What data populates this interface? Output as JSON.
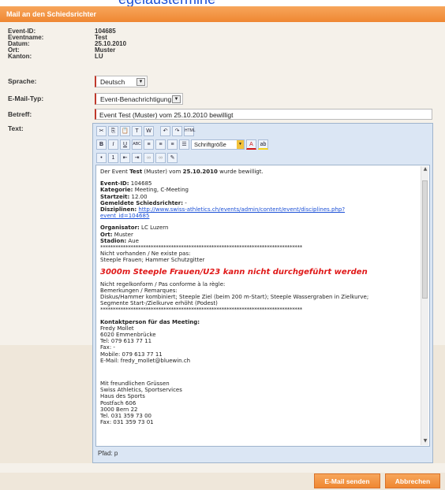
{
  "window": {
    "top_link_text": "egelaustermine",
    "title": "Mail an den Schiedsrichter"
  },
  "event_info": [
    {
      "label": "Event-ID:",
      "value": "104685"
    },
    {
      "label": "Eventname:",
      "value": "Test"
    },
    {
      "label": "Datum:",
      "value": "25.10.2010"
    },
    {
      "label": "Ort:",
      "value": "Muster"
    },
    {
      "label": "Kanton:",
      "value": "LU"
    }
  ],
  "form": {
    "sprache_label": "Sprache:",
    "sprache_value": "Deutsch",
    "mailtyp_label": "E-Mail-Typ:",
    "mailtyp_value": "Event-Benachrichtigung",
    "betreff_label": "Betreff:",
    "betreff_value": "Event Test (Muster) vom 25.10.2010 bewilligt",
    "text_label": "Text:"
  },
  "editor": {
    "toolbar_font_size": "Schriftgröße",
    "path_label": "Pfad: p",
    "body": {
      "l1a": "Der Event ",
      "l1b": "Test",
      "l1c": " (Muster) vom ",
      "l1d": "25.10.2010",
      "l1e": " wurde bewilligt.",
      "eventid_label": "Event-ID:",
      "eventid_value": " 104685",
      "kategorie_label": "Kategorie:",
      "kategorie_value": " Meeting, C-Meeting",
      "startzeit_label": "Startzeit:",
      "startzeit_value": " 12.00",
      "schiri_label": "Gemeldete Schiedsrichter:",
      "schiri_value": " -",
      "disziplinen_label": "Disziplinen:",
      "disziplinen_link1": "http://www.swiss-athletics.ch/events/admin/content/event/disciplines.php?",
      "disziplinen_link2": "event_id=104685",
      "organisator_label": "Organisator:",
      "organisator_value": " LC Luzern",
      "ort_label": "Ort:",
      "ort_value": " Muster",
      "stadion_label": "Stadion:",
      "stadion_value": " Aue",
      "stars": "********************************************************************************",
      "nicht_vorhanden": "Nicht vorhanden / Ne existe pas:",
      "steeple_list": "Steeple Frauen; Hammer Schutzgitter",
      "warning": "3000m Steeple Frauen/U23 kann nicht durchgeführt werden",
      "nicht_regelkonform": "Nicht regelkonform / Pas conforme à la règle:",
      "bemerkungen": "Bemerkungen / Remarques:",
      "bemerkung_1": "Diskus/Hammer kombiniert; Steeple Ziel (beim 200 m-Start); Steeple Wassergraben in Zielkurve;",
      "bemerkung_2": "Segmente Start-/Zielkurve erhöht (Podest)",
      "kontakt_label": "Kontaktperson für das Meeting:",
      "kontakt_name": "Fredy Mollet",
      "kontakt_ort": "6020 Emmenbrücke",
      "kontakt_tel": "Tel: 079 613 77 11",
      "kontakt_fax": "Fax: -",
      "kontakt_mobile": "Mobile: 079 613 77 11",
      "kontakt_email": "E-Mail: fredy_mollet@bluewin.ch",
      "gruss": "Mit freundlichen Grüssen",
      "sig1": "Swiss Athletics, Sportservices",
      "sig2": "Haus des Sports",
      "sig3": "Postfach 606",
      "sig4": "3000 Bern 22",
      "sig5": "Tel. 031 359 73 00",
      "sig6": "Fax: 031 359 73 01"
    }
  },
  "buttons": {
    "send": "E-Mail senden",
    "cancel": "Abbrechen"
  },
  "colors": {
    "accent_orange": "#ef8732",
    "warning_red": "#e01818",
    "link_blue": "#1a4fd6"
  }
}
